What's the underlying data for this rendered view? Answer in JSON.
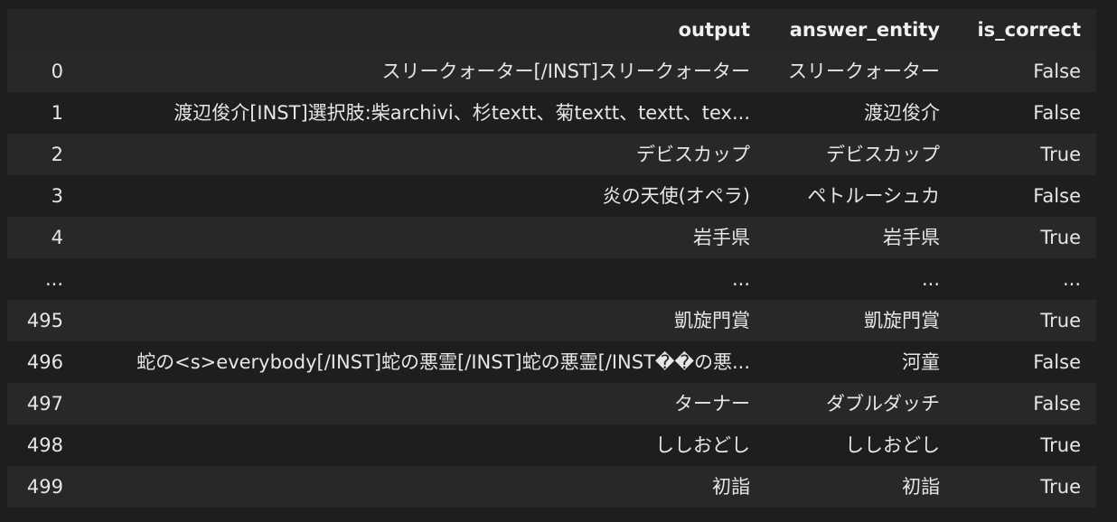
{
  "table": {
    "index_header": "",
    "columns": [
      "output",
      "answer_entity",
      "is_correct"
    ],
    "rows": [
      {
        "index": "0",
        "output": "スリークォーター[/INST]スリークォーター",
        "answer_entity": "スリークォーター",
        "is_correct": "False"
      },
      {
        "index": "1",
        "output": "渡辺俊介[INST]選択肢:柴archivi、杉textt、菊textt、textt、tex...",
        "answer_entity": "渡辺俊介",
        "is_correct": "False"
      },
      {
        "index": "2",
        "output": "デビスカップ",
        "answer_entity": "デビスカップ",
        "is_correct": "True"
      },
      {
        "index": "3",
        "output": "炎の天使(オペラ)",
        "answer_entity": "ペトルーシュカ",
        "is_correct": "False"
      },
      {
        "index": "4",
        "output": "岩手県",
        "answer_entity": "岩手県",
        "is_correct": "True"
      },
      {
        "index": "...",
        "output": "...",
        "answer_entity": "...",
        "is_correct": "..."
      },
      {
        "index": "495",
        "output": "凱旋門賞",
        "answer_entity": "凱旋門賞",
        "is_correct": "True"
      },
      {
        "index": "496",
        "output": "蛇の<s>everybody[/INST]蛇の悪霊[/INST]蛇の悪霊[/INST��の悪...",
        "answer_entity": "河童",
        "is_correct": "False"
      },
      {
        "index": "497",
        "output": "ターナー",
        "answer_entity": "ダブルダッチ",
        "is_correct": "False"
      },
      {
        "index": "498",
        "output": "ししおどし",
        "answer_entity": "ししおどし",
        "is_correct": "True"
      },
      {
        "index": "499",
        "output": "初詣",
        "answer_entity": "初詣",
        "is_correct": "True"
      }
    ]
  }
}
